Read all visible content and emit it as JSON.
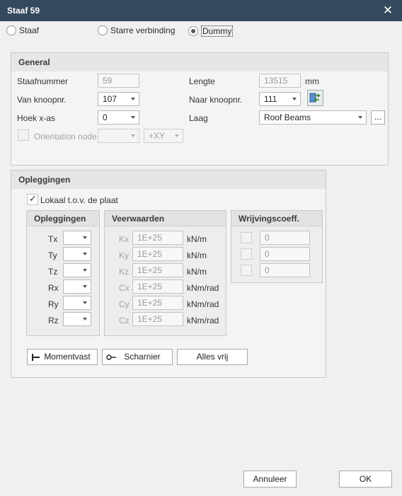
{
  "window": {
    "title": "Staaf 59",
    "close": "✕"
  },
  "mode": {
    "options": [
      "Staaf",
      "Starre verbinding",
      "Dummy"
    ],
    "selected": "Dummy"
  },
  "general": {
    "heading": "General",
    "staafnummer_label": "Staafnummer",
    "staafnummer_value": "59",
    "lengte_label": "Lengte",
    "lengte_value": "13515",
    "lengte_unit": "mm",
    "van_label": "Van knoopnr.",
    "van_value": "107",
    "naar_label": "Naar knoopnr.",
    "naar_value": "111",
    "hoek_label": "Hoek x-as",
    "hoek_value": "0",
    "laag_label": "Laag",
    "laag_value": "Roof Beams",
    "laag_more": "...",
    "orientation_label": "Orientation node",
    "orientation_value": "",
    "orientation_axis": "+XY"
  },
  "opleggingen": {
    "heading": "Opleggingen",
    "lokaal_label": "Lokaal t.o.v. de plaat",
    "lokaal_checked": true,
    "supports": {
      "heading": "Opleggingen",
      "rows": [
        {
          "label": "Tx",
          "value": ""
        },
        {
          "label": "Ty",
          "value": ""
        },
        {
          "label": "Tz",
          "value": ""
        },
        {
          "label": "Rx",
          "value": ""
        },
        {
          "label": "Ry",
          "value": ""
        },
        {
          "label": "Rz",
          "value": ""
        }
      ]
    },
    "springs": {
      "heading": "Veerwaarden",
      "rows": [
        {
          "label": "Kx",
          "value": "1E+25",
          "unit": "kN/m"
        },
        {
          "label": "Ky",
          "value": "1E+25",
          "unit": "kN/m"
        },
        {
          "label": "Kz",
          "value": "1E+25",
          "unit": "kN/m"
        },
        {
          "label": "Cx",
          "value": "1E+25",
          "unit": "kNm/rad"
        },
        {
          "label": "Cy",
          "value": "1E+25",
          "unit": "kNm/rad"
        },
        {
          "label": "Cz",
          "value": "1E+25",
          "unit": "kNm/rad"
        }
      ]
    },
    "friction": {
      "heading": "Wrijvingscoeff.",
      "rows": [
        {
          "value": "0"
        },
        {
          "value": "0"
        },
        {
          "value": "0"
        }
      ]
    },
    "buttons": {
      "momentvast": "Momentvast",
      "scharnier": "Scharnier",
      "alles_vrij": "Alles vrij"
    }
  },
  "footer": {
    "cancel": "Annuleer",
    "ok": "OK"
  }
}
